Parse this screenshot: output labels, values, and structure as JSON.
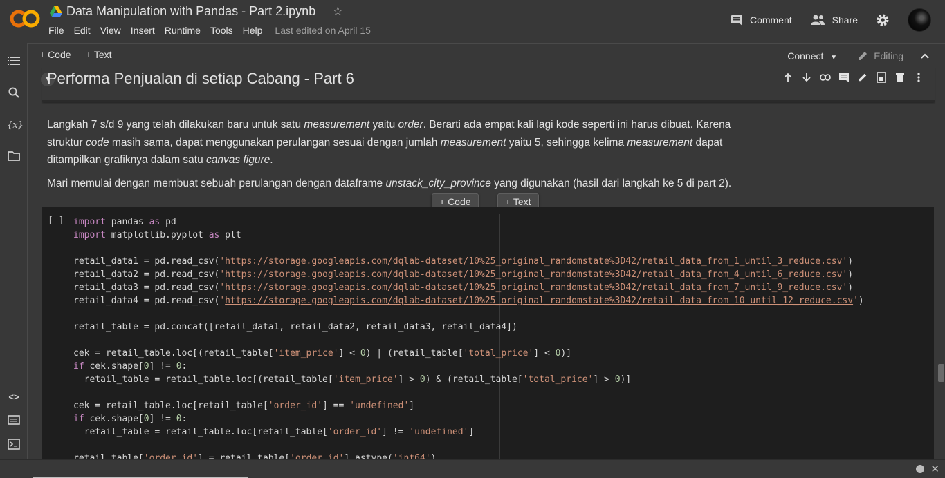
{
  "app": {
    "logo_text": "CO",
    "title": "Data Manipulation with Pandas - Part 2.ipynb",
    "menu": [
      "File",
      "Edit",
      "View",
      "Insert",
      "Runtime",
      "Tools",
      "Help"
    ],
    "last_edited": "Last edited on April 15",
    "comment_label": "Comment",
    "share_label": "Share"
  },
  "toolbar": {
    "add_code": "+ Code",
    "add_text": "+ Text",
    "connect": "Connect",
    "editing": "Editing"
  },
  "notebook": {
    "heading": "Performa Penjualan di setiap Cabang - Part 6",
    "insert_code": "+ Code",
    "insert_text": "+ Text",
    "run_bracket": "[ ]"
  },
  "colors": {
    "background": "#383838",
    "code_bg": "#1e1e1e",
    "logo_orange": "#f9ab00",
    "logo_dark_orange": "#e8710a"
  }
}
